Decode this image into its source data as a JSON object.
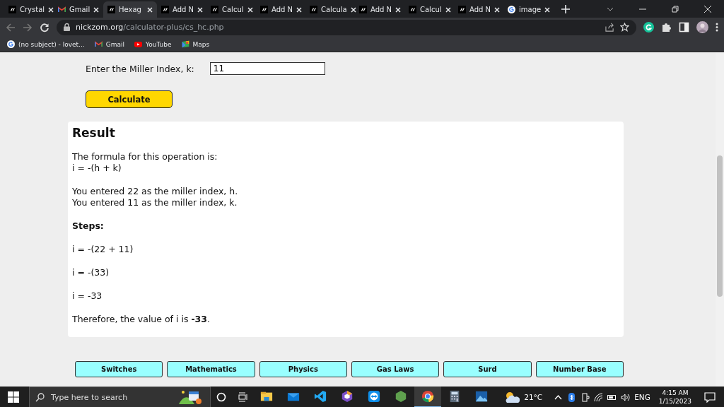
{
  "browser": {
    "tabs": [
      {
        "title": "Crystal",
        "kind": "site",
        "selected": false
      },
      {
        "title": "Gmail",
        "kind": "gmail",
        "selected": false
      },
      {
        "title": "Hexag",
        "kind": "site",
        "selected": true
      },
      {
        "title": "Add N",
        "kind": "site",
        "selected": false
      },
      {
        "title": "Calcul",
        "kind": "site",
        "selected": false
      },
      {
        "title": "Add N",
        "kind": "site",
        "selected": false
      },
      {
        "title": "Calcula",
        "kind": "site",
        "selected": false
      },
      {
        "title": "Add N",
        "kind": "site",
        "selected": false
      },
      {
        "title": "Calcul",
        "kind": "site",
        "selected": false
      },
      {
        "title": "Add N",
        "kind": "site",
        "selected": false
      },
      {
        "title": "image",
        "kind": "google",
        "selected": false
      }
    ],
    "url": {
      "domain": "nickzom.org",
      "path": "/calculator-plus/cs_hc.php"
    },
    "bookmarks": [
      {
        "label": "(no subject) - lovet...",
        "kind": "google"
      },
      {
        "label": "Gmail",
        "kind": "gmail"
      },
      {
        "label": "YouTube",
        "kind": "youtube"
      },
      {
        "label": "Maps",
        "kind": "maps"
      }
    ]
  },
  "page": {
    "field": {
      "label": "Enter the Miller Index, k:",
      "value": "11"
    },
    "calculate_button": "Calculate",
    "result": {
      "title": "Result",
      "blocks": [
        {
          "kind": "text",
          "lines": [
            "The formula for this operation is:",
            "i = -(h + k)"
          ]
        },
        {
          "kind": "text",
          "lines": [
            "You entered 22 as the miller index, h.",
            "You entered 11 as the miller index, k."
          ]
        },
        {
          "kind": "heading",
          "lines": [
            "Steps:"
          ]
        },
        {
          "kind": "text",
          "lines": [
            "i = -(22 + 11)"
          ]
        },
        {
          "kind": "text",
          "lines": [
            "i = -(33)"
          ]
        },
        {
          "kind": "text",
          "lines": [
            "i = -33"
          ]
        },
        {
          "kind": "text",
          "lines": [
            "Therefore, the value of i is **-33**."
          ]
        }
      ]
    },
    "nav_buttons": [
      "Switches",
      "Mathematics",
      "Physics",
      "Gas Laws",
      "Surd",
      "Number Base"
    ]
  },
  "taskbar": {
    "search_placeholder": "Type here to search",
    "apps": [
      {
        "kind": "explorer",
        "selected": false
      },
      {
        "kind": "mail",
        "selected": false
      },
      {
        "kind": "code",
        "selected": false
      },
      {
        "kind": "cube",
        "selected": false
      },
      {
        "kind": "remote",
        "selected": false
      },
      {
        "kind": "hexagon",
        "selected": false
      },
      {
        "kind": "chrome",
        "selected": true
      },
      {
        "kind": "calculator",
        "selected": false
      },
      {
        "kind": "photos",
        "selected": false
      }
    ],
    "temperature": "21°C",
    "language": "ENG",
    "time": "4:15 AM",
    "date": "1/15/2023"
  }
}
